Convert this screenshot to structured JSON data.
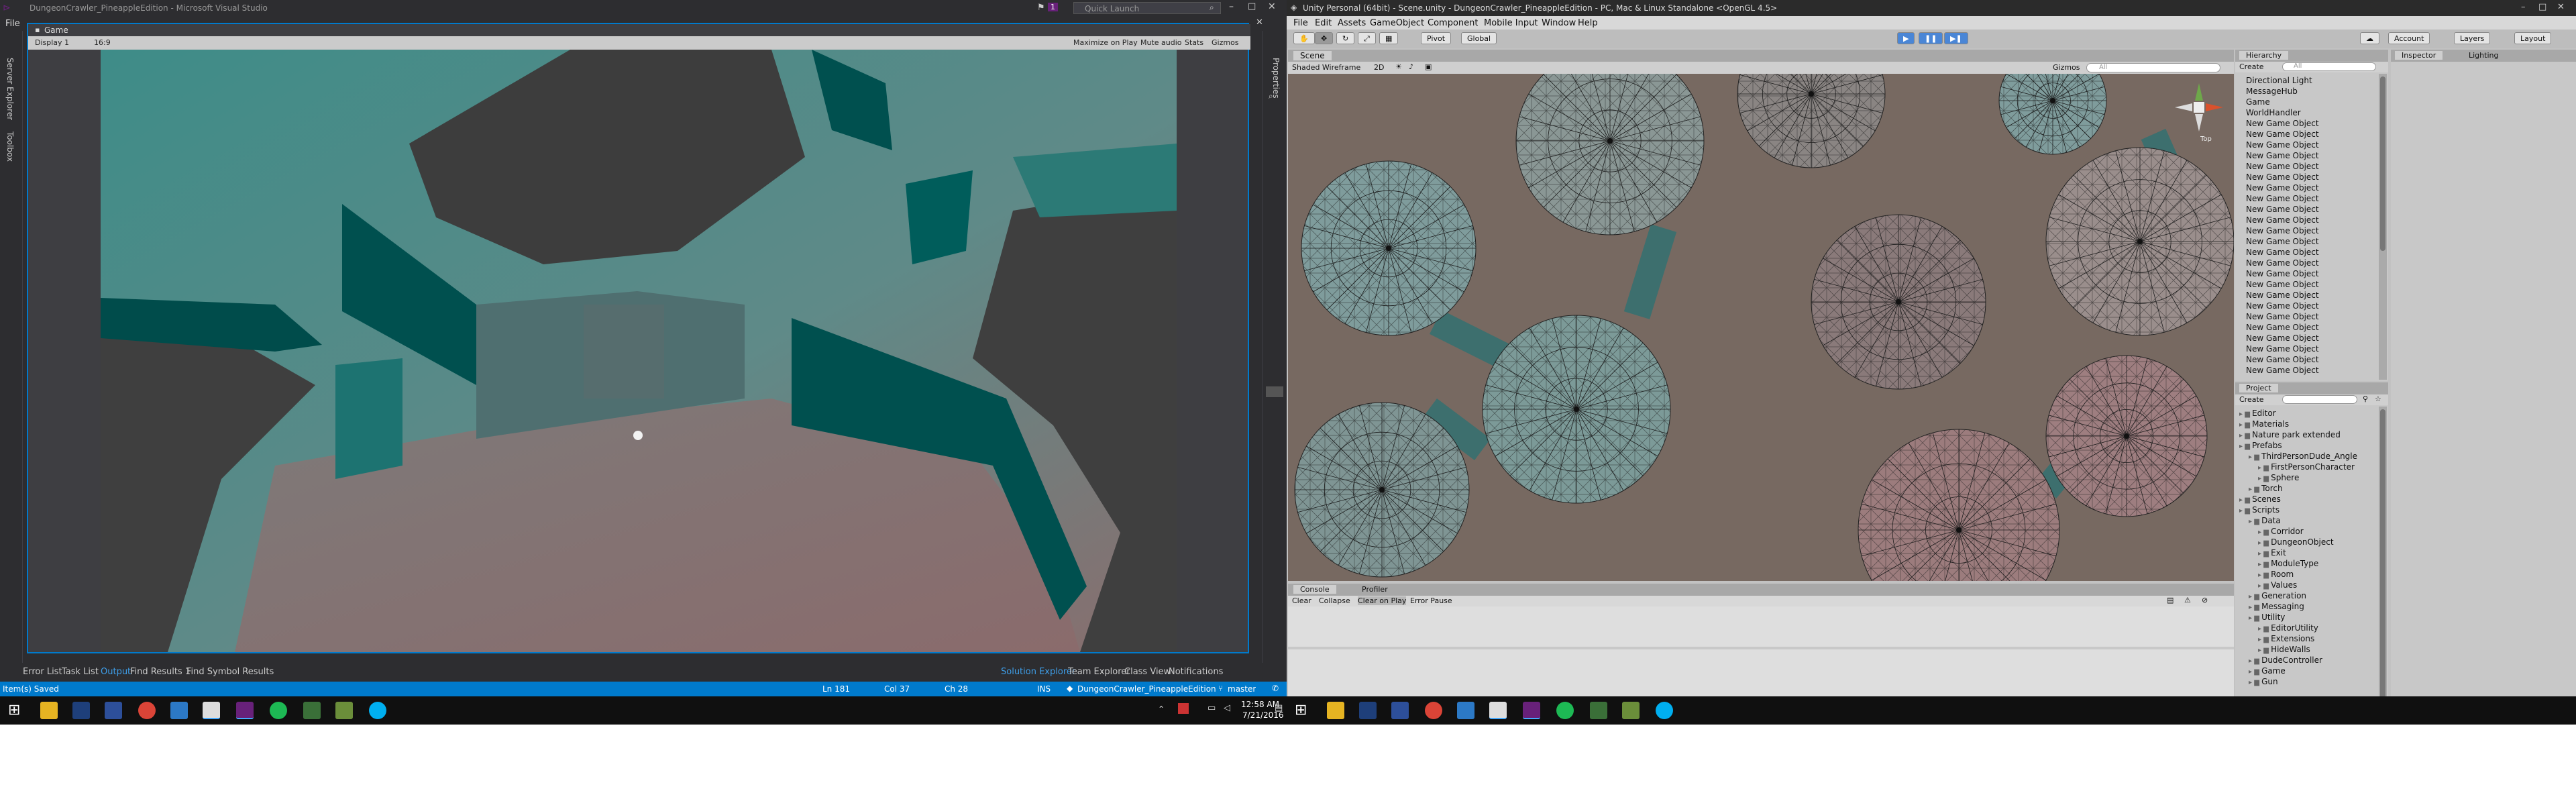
{
  "vs": {
    "title": "DungeonCrawler_PineappleEdition - Microsoft Visual Studio",
    "quick_launch_placeholder": "Quick Launch",
    "notification_count": "1",
    "menu": {
      "file": "File"
    },
    "left_strip": [
      "Server Explorer",
      "Toolbox"
    ],
    "right_strip": [
      "Properties"
    ],
    "game_tab": "Game",
    "game_toolbar": {
      "display": "Display 1",
      "aspect": "16:9",
      "buttons": [
        "Maximize on Play",
        "Mute audio",
        "Stats",
        "Gizmos"
      ]
    },
    "bottom_tabs": [
      "Error List",
      "Task List",
      "Output",
      "Find Results 1",
      "Find Symbol Results"
    ],
    "active_bottom_tab": "Output",
    "right_bottom_tabs": [
      "Solution Explorer",
      "Team Explorer",
      "Class View",
      "Notifications"
    ],
    "status": {
      "left": "Item(s) Saved",
      "ln": "Ln 181",
      "col": "Col 37",
      "ch": "Ch 28",
      "ins": "INS",
      "project": "DungeonCrawler_PineappleEdition",
      "branch": "master"
    }
  },
  "taskbar_left": {
    "time": "12:58 AM",
    "date": "7/21/2016",
    "icons": [
      "windows-start-icon",
      "file-explorer-icon",
      "app-icon",
      "app-icon",
      "chrome-icon",
      "app-icon",
      "unity-icon",
      "visual-studio-icon",
      "spotify-icon",
      "app-icon",
      "minecraft-icon",
      "skype-icon"
    ]
  },
  "taskbar_right": {
    "icons": [
      "windows-start-icon",
      "file-explorer-icon",
      "app-icon",
      "app-icon",
      "chrome-icon",
      "app-icon",
      "unity-icon",
      "visual-studio-icon",
      "spotify-icon",
      "app-icon",
      "minecraft-icon",
      "skype-icon"
    ]
  },
  "unity": {
    "title": "Unity Personal (64bit) - Scene.unity - DungeonCrawler_PineappleEdition - PC, Mac & Linux Standalone <OpenGL 4.5>",
    "menu": [
      "File",
      "Edit",
      "Assets",
      "GameObject",
      "Component",
      "Mobile Input",
      "Window",
      "Help"
    ],
    "toolbar": {
      "pivot": "Pivot",
      "global": "Global",
      "account": "Account",
      "layers": "Layers",
      "layout": "Layout"
    },
    "scene_tab": "Scene",
    "scene_bar": {
      "shading": "Shaded Wireframe",
      "mode": "2D",
      "gizmos": "Gizmos",
      "search": "All"
    },
    "gizmo_label": "Top",
    "console_tabs": [
      "Console",
      "Profiler"
    ],
    "console_buttons": [
      "Clear",
      "Collapse",
      "Clear on Play",
      "Error Pause"
    ],
    "hierarchy_tab": "Hierarchy",
    "hierarchy_create": "Create",
    "hierarchy_search": "All",
    "hierarchy_items": [
      "Directional Light",
      "MessageHub",
      "Game",
      "WorldHandler",
      "New Game Object",
      "New Game Object",
      "New Game Object",
      "New Game Object",
      "New Game Object",
      "New Game Object",
      "New Game Object",
      "New Game Object",
      "New Game Object",
      "New Game Object",
      "New Game Object",
      "New Game Object",
      "New Game Object",
      "New Game Object",
      "New Game Object",
      "New Game Object",
      "New Game Object",
      "New Game Object",
      "New Game Object",
      "New Game Object",
      "New Game Object",
      "New Game Object",
      "New Game Object",
      "New Game Object"
    ],
    "project_tab": "Project",
    "project_create": "Create",
    "project_items": [
      {
        "label": "Editor",
        "indent": 0
      },
      {
        "label": "Materials",
        "indent": 0
      },
      {
        "label": "Nature park extended",
        "indent": 0
      },
      {
        "label": "Prefabs",
        "indent": 0
      },
      {
        "label": "ThirdPersonDude_Angle",
        "indent": 1
      },
      {
        "label": "FirstPersonCharacter",
        "indent": 2
      },
      {
        "label": "Sphere",
        "indent": 2
      },
      {
        "label": "Torch",
        "indent": 1
      },
      {
        "label": "Scenes",
        "indent": 0
      },
      {
        "label": "Scripts",
        "indent": 0
      },
      {
        "label": "Data",
        "indent": 1
      },
      {
        "label": "Corridor",
        "indent": 2
      },
      {
        "label": "DungeonObject",
        "indent": 2
      },
      {
        "label": "Exit",
        "indent": 2
      },
      {
        "label": "ModuleType",
        "indent": 2
      },
      {
        "label": "Room",
        "indent": 2
      },
      {
        "label": "Values",
        "indent": 2
      },
      {
        "label": "Generation",
        "indent": 1
      },
      {
        "label": "Messaging",
        "indent": 1
      },
      {
        "label": "Utility",
        "indent": 1
      },
      {
        "label": "EditorUtility",
        "indent": 2
      },
      {
        "label": "Extensions",
        "indent": 2
      },
      {
        "label": "HideWalls",
        "indent": 2
      },
      {
        "label": "DudeController",
        "indent": 1
      },
      {
        "label": "Game",
        "indent": 1
      },
      {
        "label": "Gun",
        "indent": 1
      }
    ],
    "inspector_tab": "Inspector",
    "lighting_tab": "Lighting"
  },
  "colors": {
    "vs_accent": "#007acc",
    "teal_wall": "#00504f",
    "teal_floor": "#3a8f8a",
    "pink_floor": "#8a6f6e",
    "unity_panel": "#c8c8c8"
  }
}
